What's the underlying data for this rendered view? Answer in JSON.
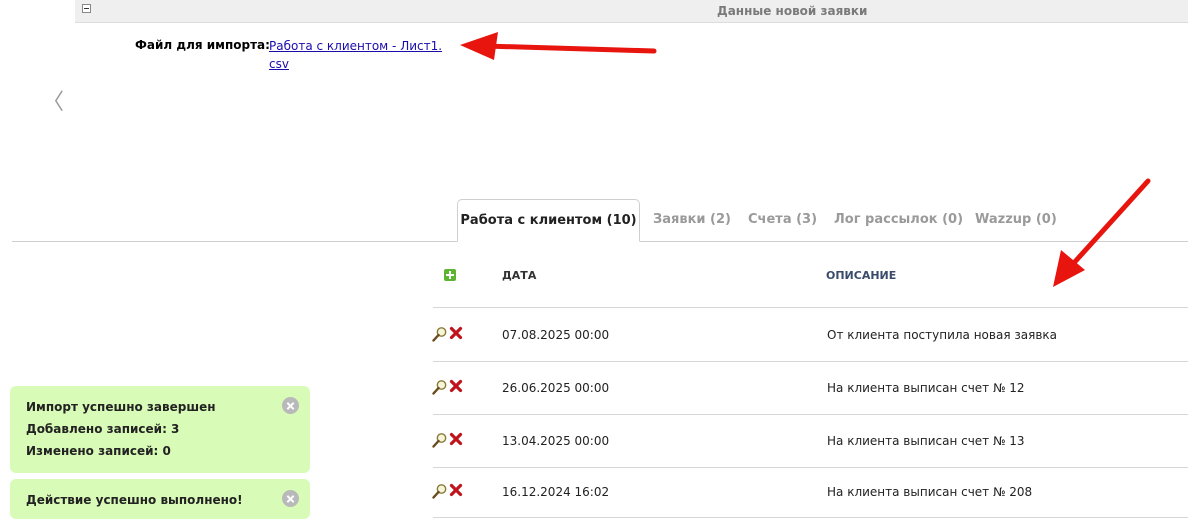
{
  "section": {
    "title": "Данные новой заявки"
  },
  "file": {
    "label": "Файл для импорта:",
    "link": "Работа с клиентом - Лист1.csv"
  },
  "back_icon": "chevron-left-icon",
  "tabs": [
    {
      "label": "Работа с клиентом (10)",
      "active": true
    },
    {
      "label": "Заявки (2)"
    },
    {
      "label": "Счета (3)"
    },
    {
      "label": "Лог рассылок (0)"
    },
    {
      "label": "Wazzup (0)"
    }
  ],
  "table": {
    "headers": {
      "date": "ДАТА",
      "description": "ОПИСАНИЕ"
    },
    "rows": [
      {
        "date": "07.08.2025 00:00",
        "description": "От клиента поступила новая заявка"
      },
      {
        "date": "26.06.2025 00:00",
        "description": "На клиента выписан счет № 12"
      },
      {
        "date": "13.04.2025 00:00",
        "description": "На клиента выписан счет № 13"
      },
      {
        "date": "16.12.2024 16:02",
        "description": "На клиента выписан счет № 208"
      }
    ]
  },
  "notifications": [
    {
      "lines": [
        "Импорт успешно завершен",
        "Добавлено записей: 3",
        "Изменено записей: 0"
      ]
    },
    {
      "lines": [
        "Действие успешно выполнено!"
      ]
    }
  ],
  "colors": {
    "toast_bg": "#d9fbb8",
    "link": "#1a0dab",
    "add_icon": "#5cb531",
    "arrow": "#e8140e",
    "delete_icon": "#c0141c"
  }
}
